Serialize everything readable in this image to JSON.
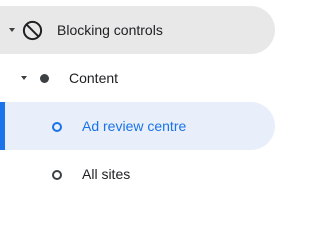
{
  "nav": {
    "items": [
      {
        "label": "Blocking controls",
        "icon": "block-icon",
        "expanded": true
      },
      {
        "label": "Content",
        "icon": "filled-dot-icon",
        "expanded": true
      },
      {
        "label": "Ad review centre",
        "icon": "ring-icon",
        "selected": true
      },
      {
        "label": "All sites",
        "icon": "ring-icon",
        "selected": false
      }
    ]
  },
  "colors": {
    "selected_text": "#1a73e8",
    "selected_bg": "#e8effb",
    "parent_bg": "#e8e8e8",
    "text": "#202124"
  }
}
